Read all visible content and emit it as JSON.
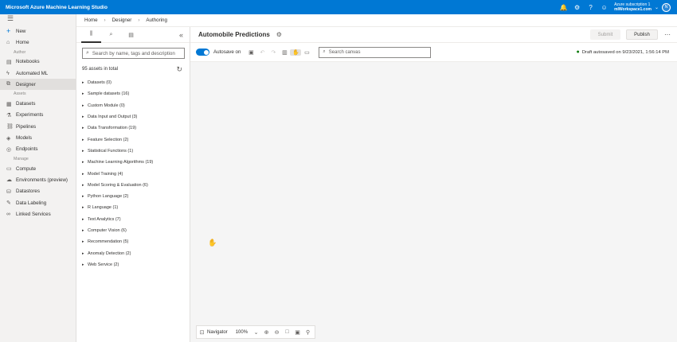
{
  "app": {
    "title": "Microsoft Azure Machine Learning Studio"
  },
  "topbar": {
    "icons": [
      "bell-icon",
      "gear-icon",
      "help-icon",
      "smiley-icon"
    ],
    "subscription": "Azure subscription 1",
    "workspace": "mlWorkspace1.com",
    "avatar_initial": "N"
  },
  "nav": {
    "new": "New",
    "home": "Home",
    "section_author": "Author",
    "notebooks": "Notebooks",
    "automated_ml": "Automated ML",
    "designer": "Designer",
    "section_assets": "Assets",
    "datasets": "Datasets",
    "experiments": "Experiments",
    "pipelines": "Pipelines",
    "models": "Models",
    "endpoints": "Endpoints",
    "section_manage": "Manage",
    "compute": "Compute",
    "environments": "Environments (preview)",
    "datastores": "Datastores",
    "data_labeling": "Data Labeling",
    "linked_services": "Linked Services"
  },
  "breadcrumb": {
    "home": "Home",
    "designer": "Designer",
    "current": "Authoring"
  },
  "palette": {
    "search_placeholder": "Search by name, tags and description",
    "assets_count": "95 assets in total",
    "categories": [
      "Datasets (0)",
      "Sample datasets (16)",
      "Custom Module (0)",
      "Data Input and Output (3)",
      "Data Transformation (19)",
      "Feature Selection (2)",
      "Statistical Functions (1)",
      "Machine Learning Algorithms (19)",
      "Model Training (4)",
      "Model Scoring & Evaluation (6)",
      "Python Language (2)",
      "R Language (1)",
      "Text Analytics (7)",
      "Computer Vision (6)",
      "Recommendation (5)",
      "Anomaly Detection (2)",
      "Web Service (2)"
    ]
  },
  "canvas": {
    "pipeline_title": "Automobile Predictions",
    "submit": "Submit",
    "publish": "Publish",
    "more": "···",
    "autosave_label": "Autosave on",
    "search_placeholder": "Search canvas",
    "status": "Draft autosaved on 9/23/2021, 1:56:14 PM",
    "navigator_label": "Navigator",
    "zoom": "100%"
  }
}
